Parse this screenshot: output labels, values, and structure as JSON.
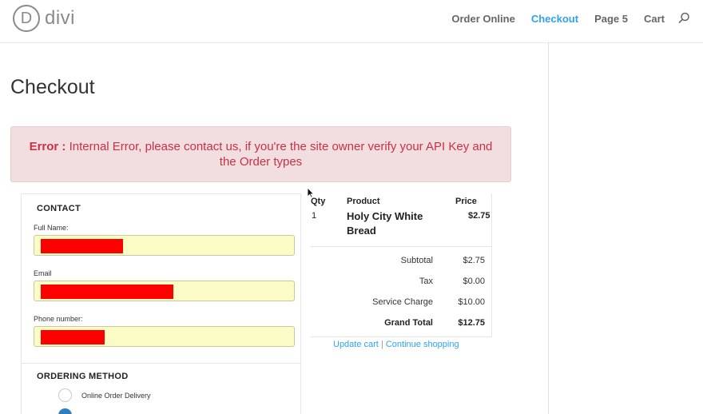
{
  "brand": {
    "name": "divi",
    "mark": "D"
  },
  "nav": {
    "items": [
      {
        "label": "Order Online",
        "active": false
      },
      {
        "label": "Checkout",
        "active": true
      },
      {
        "label": "Page 5",
        "active": false
      },
      {
        "label": "Cart",
        "active": false
      }
    ],
    "search_icon": "search-icon"
  },
  "page": {
    "title": "Checkout"
  },
  "error": {
    "label": "Error :",
    "message": "Internal Error, please contact us, if you're the site owner verify your API Key and the Order types"
  },
  "contact": {
    "section_title": "CONTACT",
    "fields": [
      {
        "label": "Full Name:",
        "value_redacted": true
      },
      {
        "label": "Email",
        "value_redacted": true
      },
      {
        "label": "Phone number:",
        "value_redacted": true
      }
    ]
  },
  "ordering_method": {
    "section_title": "ORDERING METHOD",
    "options": [
      {
        "label": "Online Order Delivery",
        "checked": false
      },
      {
        "label": "",
        "checked": true
      }
    ]
  },
  "order_summary": {
    "headers": {
      "qty": "Qty",
      "product": "Product",
      "price": "Price"
    },
    "items": [
      {
        "qty": "1",
        "product": "Holy City White Bread",
        "price": "$2.75"
      }
    ],
    "totals": [
      {
        "label": "Subtotal",
        "value": "$2.75",
        "bold": false
      },
      {
        "label": "Tax",
        "value": "$0.00",
        "bold": false
      },
      {
        "label": "Service Charge",
        "value": "$10.00",
        "bold": false
      },
      {
        "label": "Grand Total",
        "value": "$12.75",
        "bold": true
      }
    ]
  },
  "cart_links": {
    "update_cart": "Update cart",
    "separator": "|",
    "continue_shopping": "Continue shopping"
  },
  "colors": {
    "accent": "#2ea3f2",
    "error_bg": "#f2dede",
    "error_text": "#c9304a",
    "input_bg": "#fbfbc6",
    "redaction": "#ff0000"
  }
}
